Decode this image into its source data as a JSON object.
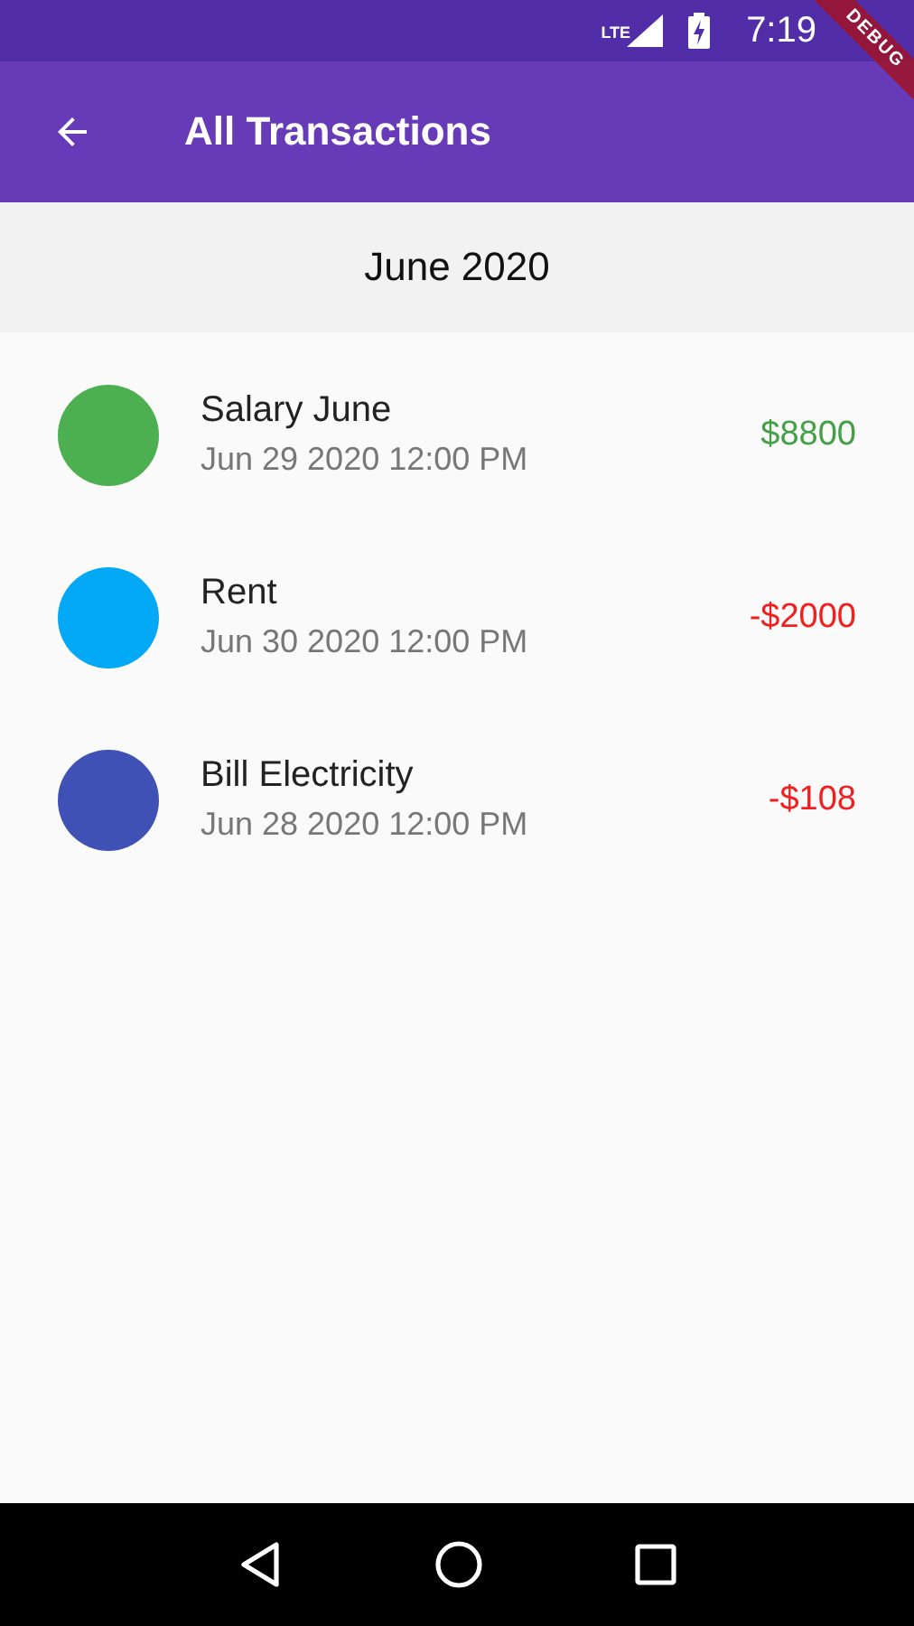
{
  "status_bar": {
    "network": "LTE",
    "time": "7:19"
  },
  "debug_banner": "DEBUG",
  "app_bar": {
    "title": "All Transactions"
  },
  "section": {
    "title": "June 2020"
  },
  "transactions": [
    {
      "name": "Salary June",
      "date": "Jun 29 2020 12:00 PM",
      "amount": "$8800",
      "kind": "income",
      "color": "#4caf50"
    },
    {
      "name": "Rent",
      "date": "Jun 30 2020 12:00 PM",
      "amount": "-$2000",
      "kind": "expense",
      "color": "#03a9f4"
    },
    {
      "name": "Bill Electricity",
      "date": "Jun 28 2020 12:00 PM",
      "amount": "-$108",
      "kind": "expense",
      "color": "#3f51b5"
    }
  ]
}
